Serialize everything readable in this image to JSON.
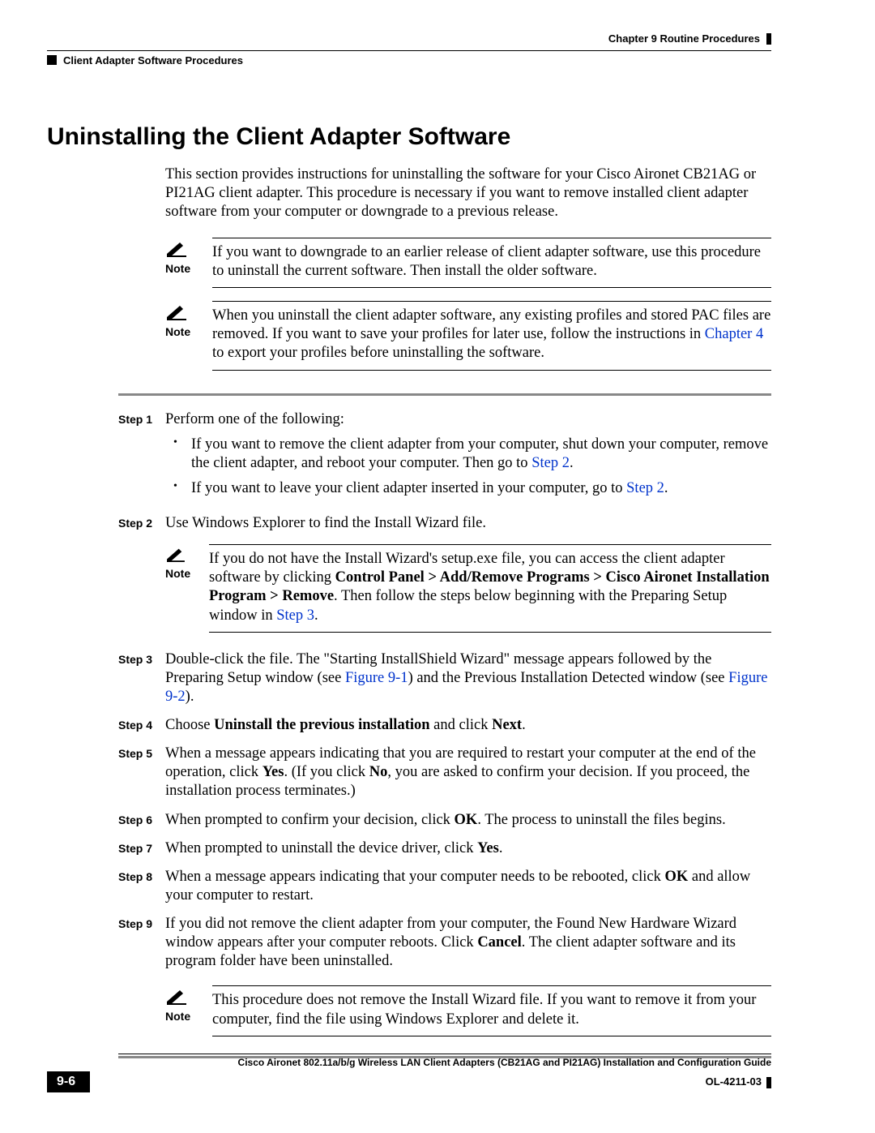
{
  "header": {
    "chapter": "Chapter 9      Routine Procedures",
    "section": "Client Adapter Software Procedures"
  },
  "title": "Uninstalling the Client Adapter Software",
  "intro": "This section provides instructions for uninstalling the software for your Cisco Aironet CB21AG or PI21AG client adapter. This procedure is necessary if you want to remove installed client adapter software from your computer or downgrade to a previous release.",
  "notes": {
    "n1_label": "Note",
    "n1_text": "If you want to downgrade to an earlier release of client adapter software, use this procedure to uninstall the current software. Then install the older software.",
    "n2_label": "Note",
    "n2_pre": "When you uninstall the client adapter software, any existing profiles and stored PAC files are removed. If you want to save your profiles for later use, follow the instructions in ",
    "n2_link": "Chapter 4",
    "n2_post": " to export your profiles before uninstalling the software.",
    "n3_label": "Note",
    "n3_pre": "If you do not have the Install Wizard's setup.exe file, you can access the client adapter software by clicking ",
    "n3_path": "Control Panel > Add/Remove Programs > Cisco Aironet Installation Program > Remove",
    "n3_mid": ". Then follow the steps below beginning with the Preparing Setup window in ",
    "n3_link": "Step 3",
    "n3_post": ".",
    "n4_label": "Note",
    "n4_text": "This procedure does not remove the Install Wizard file. If you want to remove it from your computer, find the file using Windows Explorer and delete it."
  },
  "steps": {
    "s1_label": "Step 1",
    "s1_lead": "Perform one of the following:",
    "s1_b1a": "If you want to remove the client adapter from your computer, shut down your computer, remove the client adapter, and reboot your computer. Then go to ",
    "s1_b1_link": "Step 2",
    "s1_b1b": ".",
    "s1_b2a": "If you want to leave your client adapter inserted in your computer, go to ",
    "s1_b2_link": "Step 2",
    "s1_b2b": ".",
    "s2_label": "Step 2",
    "s2_text": "Use Windows Explorer to find the Install Wizard file.",
    "s3_label": "Step 3",
    "s3_pre": "Double-click the file. The \"Starting InstallShield Wizard\" message appears followed by the Preparing Setup window (see ",
    "s3_link1": "Figure 9-1",
    "s3_mid": ") and the Previous Installation Detected window (see ",
    "s3_link2": "Figure 9-2",
    "s3_post": ").",
    "s4_label": "Step 4",
    "s4_pre": "Choose ",
    "s4_bold": "Uninstall the previous installation",
    "s4_mid": " and click ",
    "s4_bold2": "Next",
    "s4_post": ".",
    "s5_label": "Step 5",
    "s5_pre": "When a message appears indicating that you are required to restart your computer at the end of the operation, click ",
    "s5_yes": "Yes",
    "s5_mid": ". (If you click ",
    "s5_no": "No",
    "s5_post": ", you are asked to confirm your decision. If you proceed, the installation process terminates.)",
    "s6_label": "Step 6",
    "s6_pre": "When prompted to confirm your decision, click ",
    "s6_ok": "OK",
    "s6_post": ". The process to uninstall the files begins.",
    "s7_label": "Step 7",
    "s7_pre": "When prompted to uninstall the device driver, click ",
    "s7_yes": "Yes",
    "s7_post": ".",
    "s8_label": "Step 8",
    "s8_pre": "When a message appears indicating that your computer needs to be rebooted, click ",
    "s8_ok": "OK",
    "s8_post": " and allow your computer to restart.",
    "s9_label": "Step 9",
    "s9_pre": "If you did not remove the client adapter from your computer, the Found New Hardware Wizard window appears after your computer reboots. Click ",
    "s9_cancel": "Cancel",
    "s9_post": ". The client adapter software and its program folder have been uninstalled."
  },
  "footer": {
    "guide": "Cisco Aironet 802.11a/b/g Wireless LAN Client Adapters (CB21AG and PI21AG) Installation and Configuration Guide",
    "page": "9-6",
    "doc": "OL-4211-03"
  }
}
